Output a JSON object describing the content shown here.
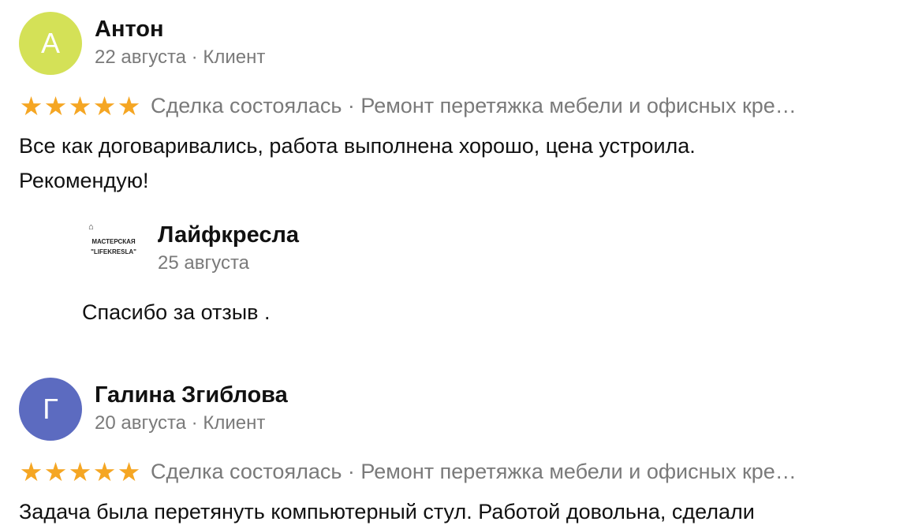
{
  "reviews": [
    {
      "avatar_letter": "А",
      "avatar_color": "#d4e157",
      "author": "Антон",
      "meta": "22 августа · Клиент",
      "deal": "Сделка состоялась · Ремонт перетяжка мебели и офисных кре…",
      "text_line1": "Все как договаривались, работа выполнена хорошо, цена устроила.",
      "text_line2": "Рекомендую!",
      "reply": {
        "logo_line1": "МАСТЕРСКАЯ",
        "logo_line2": "\"LIFEKRESLA\"",
        "author": "Лайфкресла",
        "date": "25 августа",
        "text": "Спасибо за отзыв ."
      }
    },
    {
      "avatar_letter": "Г",
      "avatar_color": "#5c6bc0",
      "author": "Галина Згиблова",
      "meta": "20 августа · Клиент",
      "deal": "Сделка состоялась · Ремонт перетяжка мебели и офисных кре…",
      "text_line1": "Задача была перетянуть компьютерный стул. Работой довольна, сделали"
    }
  ],
  "rating": {
    "stars": 5,
    "max": 5
  },
  "colors": {
    "star": "#f5a623",
    "muted_text": "#7a7a7a"
  }
}
